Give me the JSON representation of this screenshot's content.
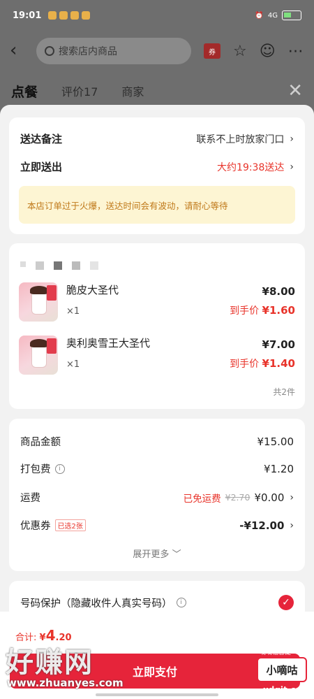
{
  "status_bar": {
    "time": "19:01",
    "network": "4G",
    "battery": "5"
  },
  "nav": {
    "search_placeholder": "搜索店内商品",
    "coupon": "券"
  },
  "tabs": [
    {
      "label": "点餐"
    },
    {
      "label": "评价17"
    },
    {
      "label": "商家"
    }
  ],
  "delivery": {
    "note_label": "送达备注",
    "note_value": "联系不上时放家门口",
    "time_label": "立即送出",
    "time_value": "大约19:38送达",
    "notice": "本店订单过于火爆，送达时间会有波动，请耐心等待"
  },
  "items": [
    {
      "name": "脆皮大圣代",
      "qty": "×1",
      "price": "¥8.00",
      "final_label": "到手价",
      "final_price": "¥1.60"
    },
    {
      "name": "奥利奥雪王大圣代",
      "qty": "×1",
      "price": "¥7.00",
      "final_label": "到手价",
      "final_price": "¥1.40"
    }
  ],
  "item_count": "共2件",
  "fees": {
    "goods_label": "商品金额",
    "goods_value": "¥15.00",
    "pack_label": "打包费",
    "pack_value": "¥1.20",
    "ship_label": "运费",
    "ship_free": "已免运费",
    "ship_orig": "¥2.70",
    "ship_value": "¥0.00",
    "coupon_label": "优惠券",
    "coupon_badge": "已选2张",
    "coupon_value": "-¥12.00",
    "expand": "展开更多"
  },
  "privacy": {
    "label": "号码保护（隐藏收件人真实号码）"
  },
  "footer": {
    "total_label": "合计:",
    "total_symbol": "¥",
    "total_int": "4",
    "total_dec": ".20",
    "pay_label": "立即支付"
  },
  "watermark": {
    "left": "好赚网",
    "url": "www.zhuanyes.com",
    "badge": "小嘀咕",
    "right": "xdgit.com",
    "mini": "嘀嘀福音提"
  },
  "colors": {
    "accent": "#e6243a",
    "price_red": "#e8332a",
    "notice_bg": "#fdf5d3"
  }
}
